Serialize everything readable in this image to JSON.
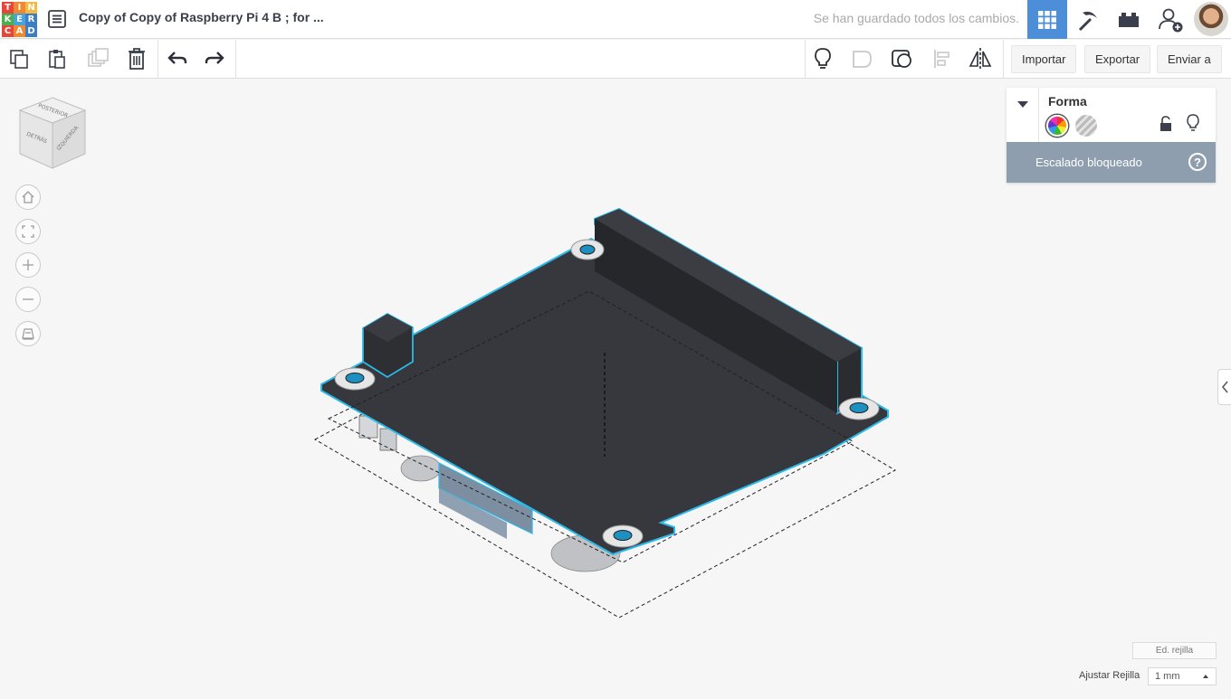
{
  "logo": {
    "letters": [
      "T",
      "I",
      "N",
      "K",
      "E",
      "R",
      "C",
      "A",
      "D"
    ],
    "colors": [
      "#e3473b",
      "#f0882f",
      "#f4b940",
      "#4bae4f",
      "#47a3dc",
      "#3c7ec1",
      "#e3473b",
      "#f0882f",
      "#3c7ec1"
    ]
  },
  "header": {
    "title": "Copy of Copy of Raspberry Pi 4 B ; for ...",
    "save_status": "Se han guardado todos los cambios."
  },
  "toolbar": {
    "import_label": "Importar",
    "export_label": "Exportar",
    "send_label": "Enviar a"
  },
  "viewcube": {
    "top_face": "POSTERIOR",
    "left_face": "DETRÁS",
    "right_face": "IZQUIERDA"
  },
  "inspector": {
    "title": "Forma",
    "locked_message": "Escalado bloqueado",
    "help_symbol": "?"
  },
  "grid": {
    "edit_label": "Ed. rejilla",
    "snap_label": "Ajustar Rejilla",
    "snap_value": "1 mm"
  },
  "colors": {
    "accent": "#4d8ed8",
    "selection": "#2bb9e8",
    "board": "#36383d",
    "locked_bar": "#8f9eae"
  }
}
